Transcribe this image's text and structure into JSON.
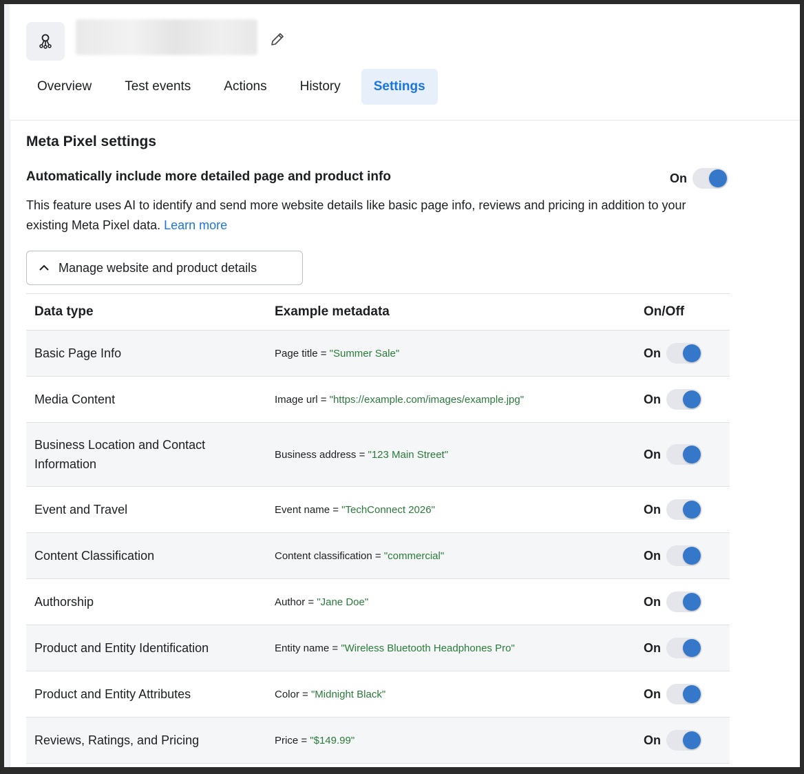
{
  "header": {
    "tabs": [
      {
        "label": "Overview",
        "active": false
      },
      {
        "label": "Test events",
        "active": false
      },
      {
        "label": "Actions",
        "active": false
      },
      {
        "label": "History",
        "active": false
      },
      {
        "label": "Settings",
        "active": true
      }
    ]
  },
  "settings": {
    "section_title": "Meta Pixel settings",
    "feature_title": "Automatically include more detailed page and product info",
    "master_toggle_label": "On",
    "master_toggle_on": true,
    "description": "This feature uses AI to identify and send more website details like basic page info, reviews and pricing in addition to your existing Meta Pixel data.",
    "learn_more": "Learn more",
    "manage_button": "Manage website and product details"
  },
  "table": {
    "headers": [
      "Data type",
      "Example metadata",
      "On/Off"
    ],
    "rows": [
      {
        "type": "Basic Page Info",
        "meta_key": "Page title = ",
        "meta_val": "\"Summer Sale\"",
        "status": "On"
      },
      {
        "type": "Media Content",
        "meta_key": "Image url = ",
        "meta_val": "\"https://example.com/images/example.jpg\"",
        "status": "On"
      },
      {
        "type": "Business Location and Contact Information",
        "meta_key": "Business address = ",
        "meta_val": "\"123 Main Street\"",
        "status": "On"
      },
      {
        "type": "Event and Travel",
        "meta_key": "Event name = ",
        "meta_val": "\"TechConnect 2026\"",
        "status": "On"
      },
      {
        "type": "Content Classification",
        "meta_key": "Content classification = ",
        "meta_val": "\"commercial\"",
        "status": "On"
      },
      {
        "type": "Authorship",
        "meta_key": "Author = ",
        "meta_val": "\"Jane Doe\"",
        "status": "On"
      },
      {
        "type": "Product and Entity Identification",
        "meta_key": "Entity name = ",
        "meta_val": "\"Wireless Bluetooth Headphones Pro\"",
        "status": "On"
      },
      {
        "type": "Product and Entity Attributes",
        "meta_key": "Color = ",
        "meta_val": "\"Midnight Black\"",
        "status": "On"
      },
      {
        "type": "Reviews, Ratings, and Pricing",
        "meta_key": "Price = ",
        "meta_val": "\"$149.99\"",
        "status": "On"
      }
    ]
  },
  "colors": {
    "accent": "#1b74e4",
    "toggle_knob": "#3577c8",
    "metadata_value": "#2a7a3b"
  }
}
